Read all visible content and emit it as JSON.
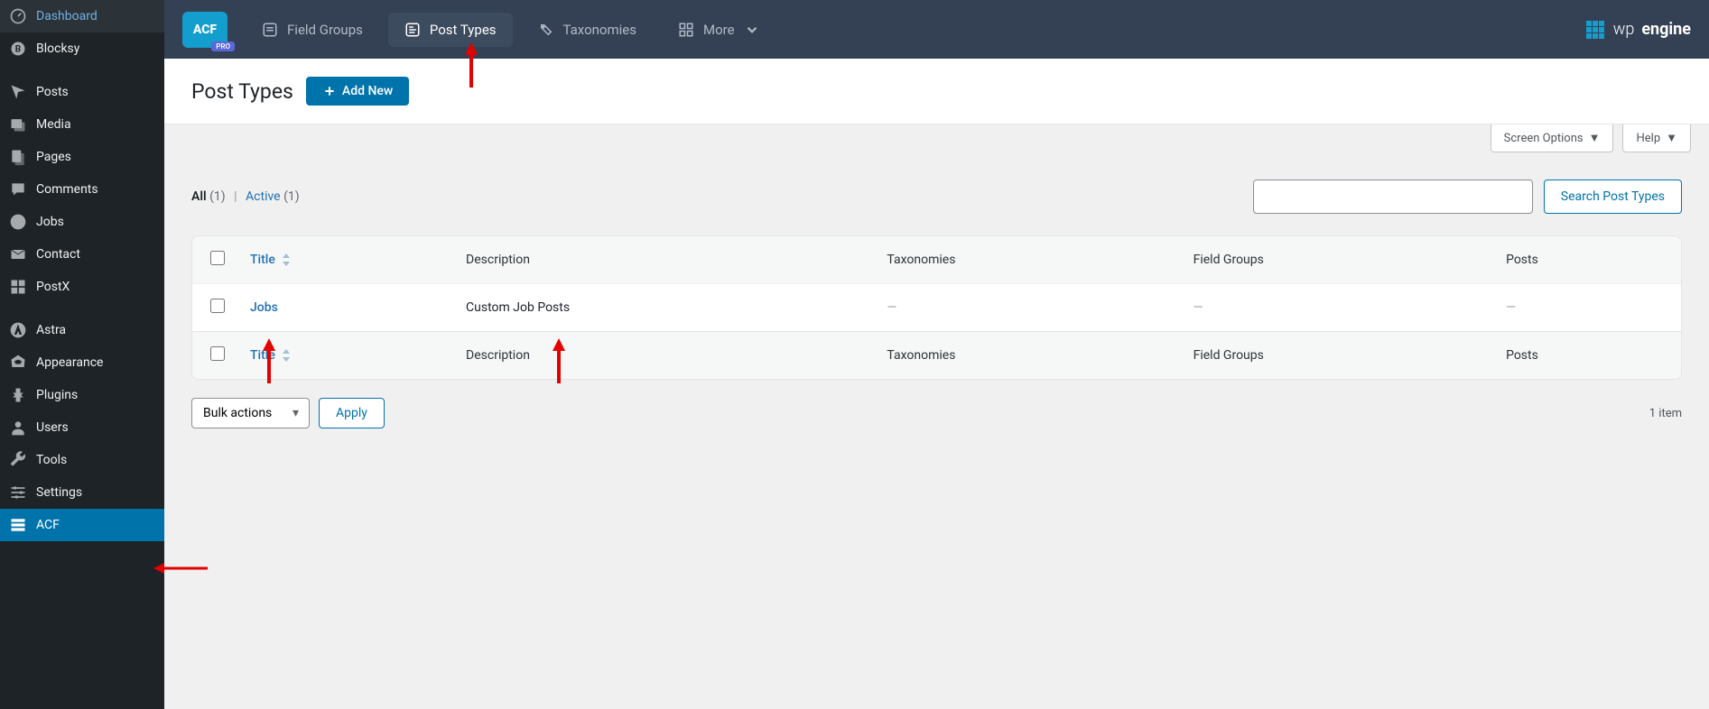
{
  "sidebar": {
    "items": [
      {
        "label": "Dashboard"
      },
      {
        "label": "Blocksy"
      },
      {
        "label": "Posts"
      },
      {
        "label": "Media"
      },
      {
        "label": "Pages"
      },
      {
        "label": "Comments"
      },
      {
        "label": "Jobs"
      },
      {
        "label": "Contact"
      },
      {
        "label": "PostX"
      },
      {
        "label": "Astra"
      },
      {
        "label": "Appearance"
      },
      {
        "label": "Plugins"
      },
      {
        "label": "Users"
      },
      {
        "label": "Tools"
      },
      {
        "label": "Settings"
      },
      {
        "label": "ACF"
      }
    ]
  },
  "topnav": {
    "logo_text": "ACF",
    "logo_badge": "PRO",
    "items": [
      {
        "label": "Field Groups"
      },
      {
        "label": "Post Types"
      },
      {
        "label": "Taxonomies"
      },
      {
        "label": "More"
      }
    ],
    "brand": "wpengine"
  },
  "page": {
    "title": "Post Types",
    "add_new_label": "Add New",
    "screen_options": "Screen Options",
    "help": "Help"
  },
  "filters": {
    "all_label": "All",
    "all_count": "(1)",
    "active_label": "Active",
    "active_count": "(1)"
  },
  "search": {
    "placeholder": "",
    "button": "Search Post Types"
  },
  "table": {
    "columns": {
      "title": "Title",
      "description": "Description",
      "taxonomies": "Taxonomies",
      "field_groups": "Field Groups",
      "posts": "Posts"
    },
    "rows": [
      {
        "title": "Jobs",
        "description": "Custom Job Posts",
        "taxonomies": "—",
        "field_groups": "—",
        "posts": "—"
      }
    ]
  },
  "bulk": {
    "placeholder": "Bulk actions",
    "apply": "Apply",
    "count": "1 item"
  }
}
